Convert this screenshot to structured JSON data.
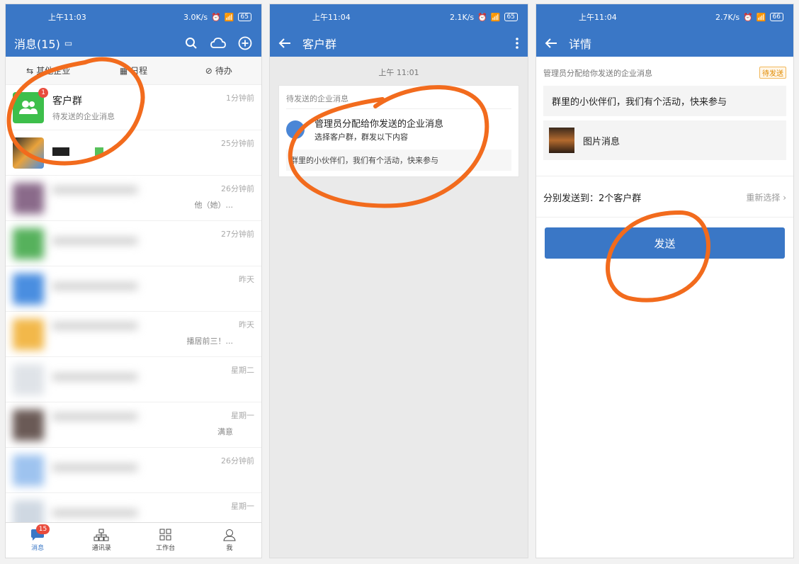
{
  "panel1": {
    "status": {
      "time": "上午11:03",
      "speed": "3.0K/s",
      "battery": "65"
    },
    "appbar": {
      "title": "消息(15)"
    },
    "quickbar": [
      {
        "label": "其他企业",
        "icon": "switch-icon"
      },
      {
        "label": "日程",
        "icon": "calendar-icon"
      },
      {
        "label": "待办",
        "icon": "check-circle-icon"
      }
    ],
    "conversations": [
      {
        "name": "客户群",
        "sub": "待发送的企业消息",
        "time": "1分钟前",
        "badge": "1"
      },
      {
        "name": "",
        "sub": "",
        "time": "25分钟前"
      },
      {
        "name": "",
        "sub": "他（她）...",
        "time": "26分钟前"
      },
      {
        "name": "",
        "sub": "",
        "time": "27分钟前"
      },
      {
        "name": "",
        "sub": "",
        "time": "昨天"
      },
      {
        "name": "",
        "sub": "播居前三！...",
        "time": "昨天"
      },
      {
        "name": "",
        "sub": "",
        "time": "星期二"
      },
      {
        "name": "",
        "sub": "满意",
        "time": "星期一"
      },
      {
        "name": "",
        "sub": "",
        "time": "26分钟前"
      },
      {
        "name": "",
        "sub": "",
        "time": "星期一"
      }
    ],
    "tabs": [
      {
        "label": "消息",
        "icon": "chat-icon",
        "badge": "15"
      },
      {
        "label": "通讯录",
        "icon": "org-chart-icon"
      },
      {
        "label": "工作台",
        "icon": "grid-icon"
      },
      {
        "label": "我",
        "icon": "person-icon"
      }
    ]
  },
  "panel2": {
    "status": {
      "time": "上午11:04",
      "speed": "2.1K/s",
      "battery": "65"
    },
    "appbar": {
      "title": "客户群"
    },
    "timestamp": "上午 11:01",
    "card": {
      "title": "待发送的企业消息",
      "main": "管理员分配给你发送的企业消息",
      "desc": "选择客户群，群发以下内容",
      "content": "群里的小伙伴们，我们有个活动，快来参与"
    }
  },
  "panel3": {
    "status": {
      "time": "上午11:04",
      "speed": "2.7K/s",
      "battery": "66"
    },
    "appbar": {
      "title": "详情"
    },
    "section_label": "管理员分配给你发送的企业消息",
    "pending": "待发送",
    "message": "群里的小伙伴们，我们有个活动，快来参与",
    "image_label": "图片消息",
    "sendto": "分别发送到：2个客户群",
    "reselect": "重新选择",
    "send": "发送"
  },
  "colors": {
    "brand": "#3a77c6",
    "annotation": "#f26b1d",
    "badge": "#e94b3c"
  }
}
